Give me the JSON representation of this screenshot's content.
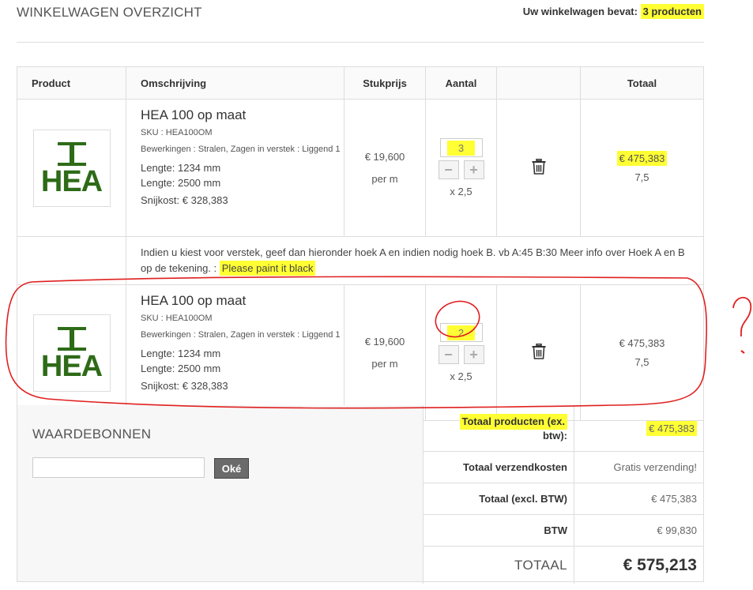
{
  "header": {
    "title": "WINKELWAGEN OVERZICHT",
    "cart_label": "Uw winkelwagen bevat:",
    "cart_count": "3 producten"
  },
  "table": {
    "headers": [
      "Product",
      "Omschrijving",
      "Stukprijs",
      "Aantal",
      "",
      "Totaal"
    ],
    "rows": [
      {
        "image_text": "HEA",
        "name": "HEA 100 op maat",
        "sku": "SKU : HEA100OM",
        "bewerkingen": "Bewerkingen : Stralen, Zagen in verstek : Liggend 1",
        "lengte1": "Lengte: 1234 mm",
        "lengte2": "Lengte: 2500 mm",
        "snijkost": "Snijkost: € 328,383",
        "price": "€ 19,600",
        "price_unit": "per m",
        "qty": "3",
        "multiplier": "x 2,5",
        "total": "€ 475,383",
        "total_sub": "7,5"
      },
      {
        "image_text": "HEA",
        "name": "HEA 100 op maat",
        "sku": "SKU : HEA100OM",
        "bewerkingen": "Bewerkingen : Stralen, Zagen in verstek : Liggend 1",
        "lengte1": "Lengte: 1234 mm",
        "lengte2": "Lengte: 2500 mm",
        "snijkost": "Snijkost: € 328,383",
        "price": "€ 19,600",
        "price_unit": "per m",
        "qty": "2",
        "multiplier": "x 2,5",
        "total": "€ 475,383",
        "total_sub": "7,5"
      }
    ],
    "note": "Indien u kiest voor verstek, geef dan hieronder hoek A en indien nodig hoek B. vb A:45 B:30 Meer info over Hoek A en B op de tekening. :",
    "note_value": "Please paint it black"
  },
  "voucher": {
    "title": "WAARDEBONNEN",
    "button": "Oké"
  },
  "totals": {
    "products_label_1": "Totaal producten (ex.",
    "products_label_2": "btw):",
    "products_value": "€ 475,383",
    "shipping_label": "Totaal verzendkosten",
    "shipping_value": "Gratis verzending!",
    "excl_label": "Totaal (excl. BTW)",
    "excl_value": "€ 475,383",
    "btw_label": "BTW",
    "btw_value": "€ 99,830",
    "grand_label": "TOTAAL",
    "grand_value": "€ 575,213"
  },
  "colors": {
    "highlight": "#ffff33",
    "annotation": "#e02020",
    "logo_green": "#2e6b18"
  }
}
